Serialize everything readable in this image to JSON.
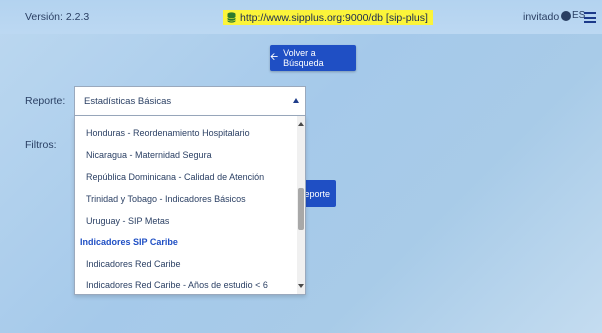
{
  "header": {
    "version": "Versión: 2.2.3",
    "url": "http://www.sipplus.org:9000/db [sip-plus]",
    "user": "invitado",
    "lang": "ES",
    "url_highlight_color": "#fbf43a",
    "accent_color": "#1f4fc4"
  },
  "toolbar": {
    "back_label": "Volver a Búsqueda"
  },
  "form": {
    "reporte_label": "Reporte:",
    "filtros_label": "Filtros:",
    "selected_report": "Estadísticas Básicas",
    "report_button_label": "eporte"
  },
  "dropdown": {
    "items": [
      "Honduras - Reordenamiento Hospitalario",
      "Nicaragua - Maternidad Segura",
      "República Dominicana - Calidad de Atención",
      "Trinidad y Tobago - Indicadores Básicos",
      "Uruguay - SIP Metas"
    ],
    "group_label": "Indicadores SIP Caribe",
    "group_items": [
      "Indicadores Red Caribe",
      "Indicadores Red Caribe - Años de estudio < 6"
    ]
  }
}
